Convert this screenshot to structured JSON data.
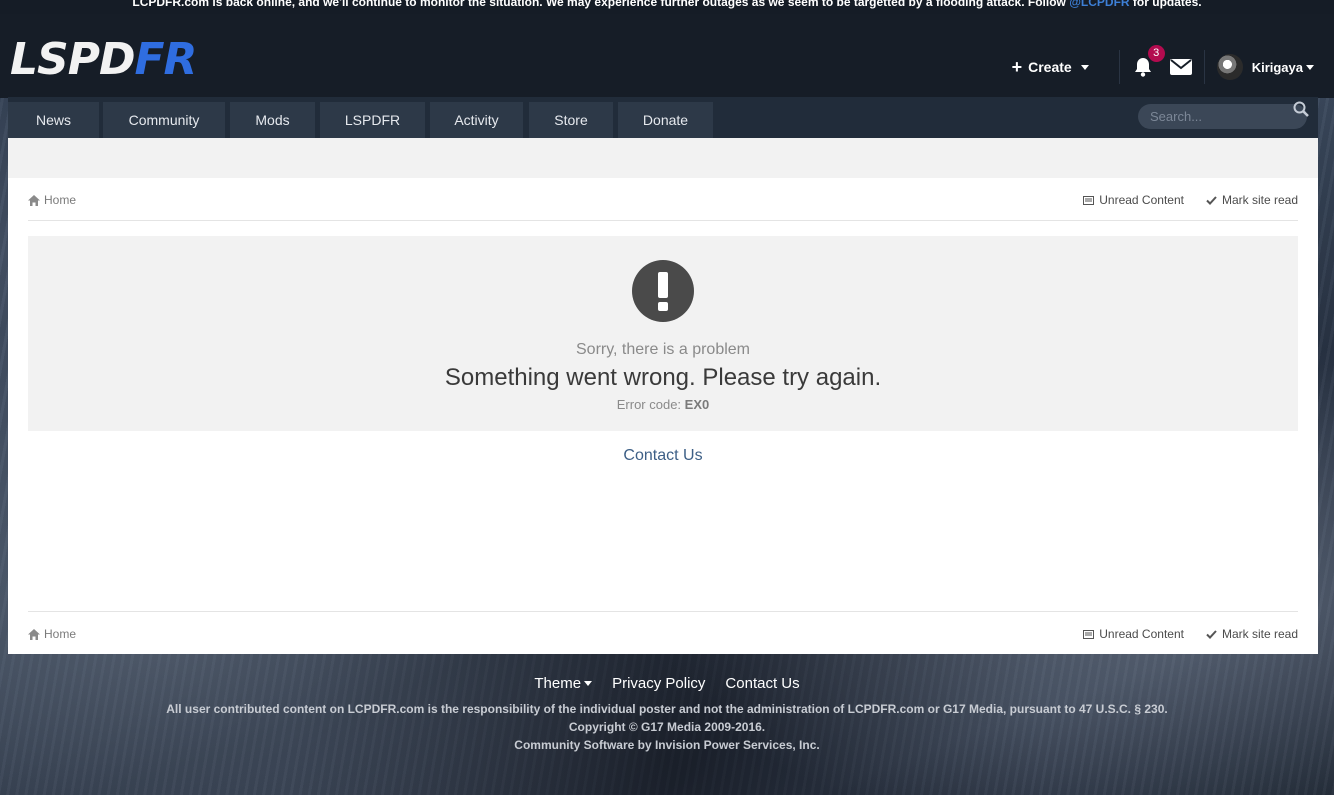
{
  "announcement": {
    "text": "LCPDFR.com is back online, and we'll continue to monitor the situation. We may experience further outages as we seem to be targetted by a flooding attack. Follow",
    "link": "@LCPDFR",
    "suffix": "for updates."
  },
  "logo": {
    "part1": "LSPD",
    "part2": "FR"
  },
  "userbar": {
    "create_label": "Create",
    "notification_count": "3",
    "username": "Kirigaya"
  },
  "nav": {
    "tabs": [
      "News",
      "Community",
      "Mods",
      "LSPDFR",
      "Activity",
      "Store",
      "Donate"
    ],
    "search_placeholder": "Search..."
  },
  "breadcrumb": {
    "home": "Home",
    "unread": "Unread Content",
    "mark_read": "Mark site read"
  },
  "error": {
    "subtitle": "Sorry, there is a problem",
    "message": "Something went wrong. Please try again.",
    "code_label": "Error code:",
    "code": "EX0"
  },
  "contact_label": "Contact Us",
  "footer": {
    "theme": "Theme",
    "privacy": "Privacy Policy",
    "contact": "Contact Us",
    "legal1": "All user contributed content on LCPDFR.com is the responsibility of the individual poster and not the administration of LCPDFR.com or G17 Media, pursuant to 47 U.S.C. § 230.",
    "legal2": "Copyright © G17 Media 2009-2016.",
    "legal3": "Community Software by Invision Power Services, Inc."
  },
  "colors": {
    "header_bg": "#161d27",
    "logo_accent": "#2f6de0",
    "badge": "#b30b4f",
    "link": "#3d5f86"
  }
}
